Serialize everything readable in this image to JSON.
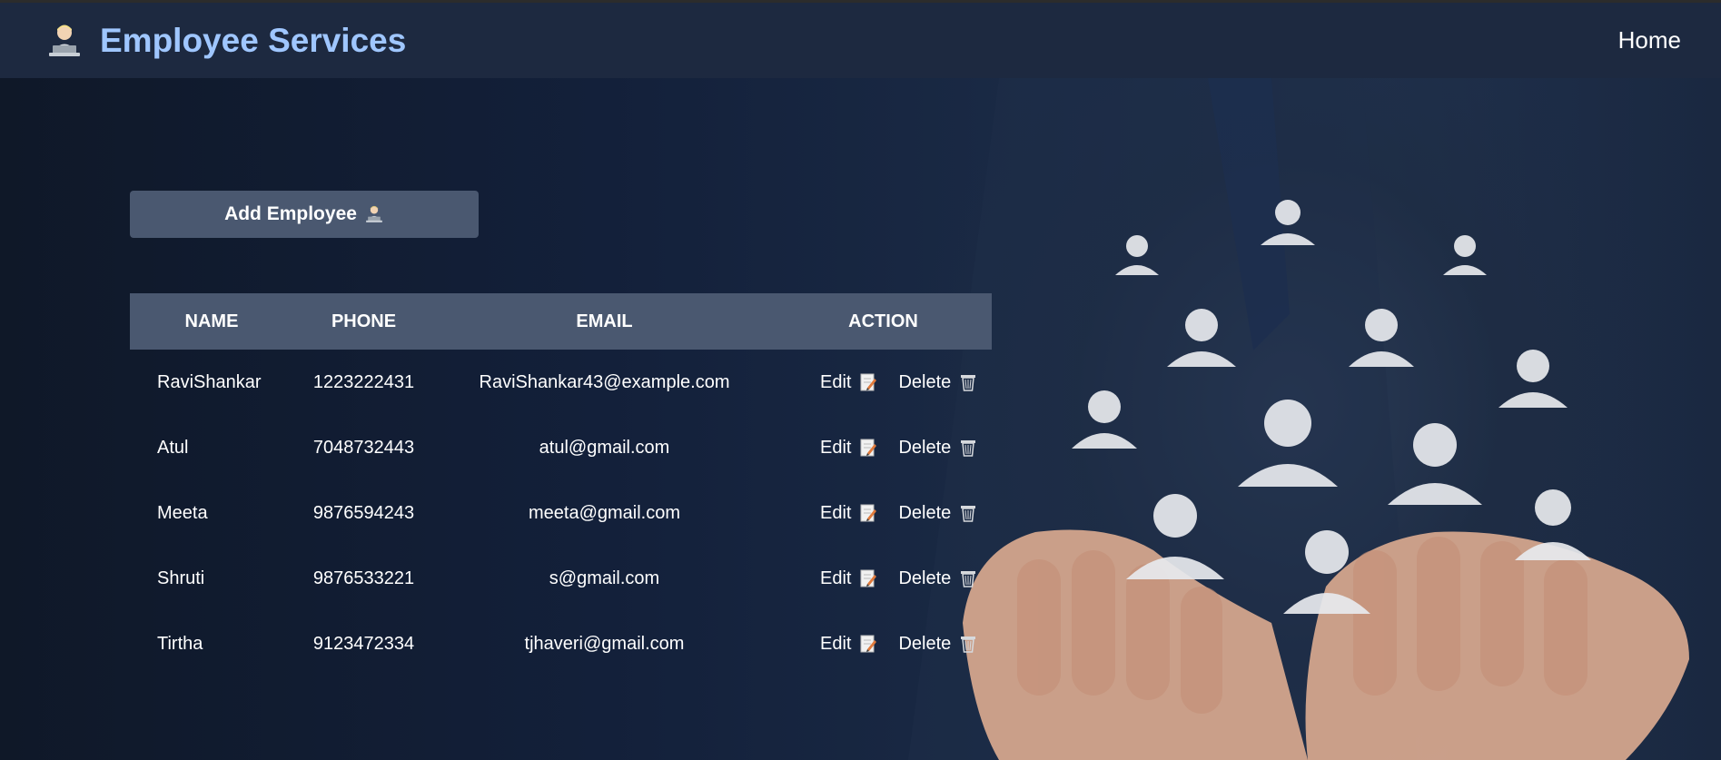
{
  "header": {
    "title": "Employee Services",
    "logo_icon": "office-worker-icon",
    "nav": {
      "home_label": "Home"
    }
  },
  "main": {
    "add_button_label": "Add Employee",
    "add_button_icon": "office-worker-icon",
    "table": {
      "columns": [
        "NAME",
        "PHONE",
        "EMAIL",
        "ACTION"
      ],
      "edit_label": "Edit",
      "edit_icon": "memo-pencil-icon",
      "delete_label": "Delete",
      "delete_icon": "wastebasket-icon",
      "rows": [
        {
          "name": "RaviShankar",
          "phone": "1223222431",
          "email": "RaviShankar43@example.com"
        },
        {
          "name": "Atul",
          "phone": "7048732443",
          "email": "atul@gmail.com"
        },
        {
          "name": "Meeta",
          "phone": "9876594243",
          "email": "meeta@gmail.com"
        },
        {
          "name": "Shruti",
          "phone": "9876533221",
          "email": "s@gmail.com"
        },
        {
          "name": "Tirtha",
          "phone": "9123472334",
          "email": "tjhaveri@gmail.com"
        }
      ]
    }
  },
  "colors": {
    "navbar_bg": "#1d2940",
    "brand_title": "#9fc6ff",
    "button_bg": "#4a5870",
    "table_header_bg": "#4a5870",
    "text": "#ffffff"
  }
}
